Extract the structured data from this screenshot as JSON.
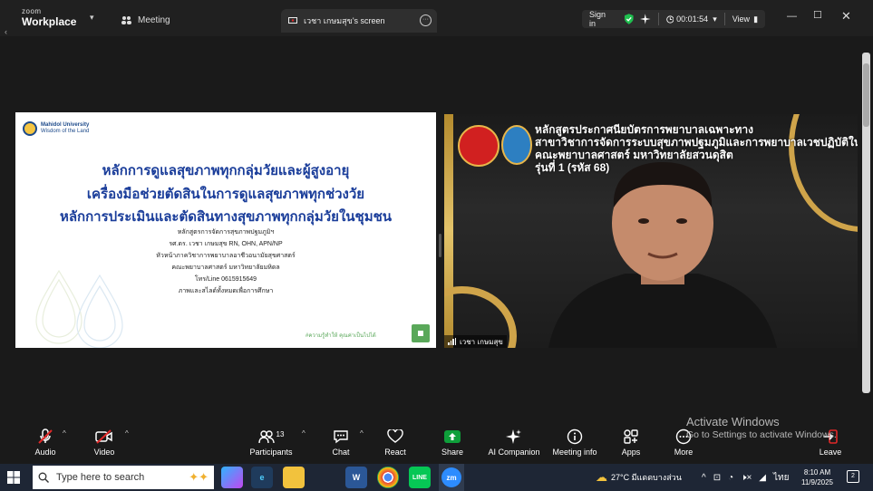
{
  "app": {
    "logo_top": "zoom",
    "logo_bottom": "Workplace",
    "meeting_label": "Meeting"
  },
  "tab": {
    "title": "เวชา เกษมสุข's screen"
  },
  "header": {
    "sign_in": "Sign in",
    "timer": "00:01:54",
    "view": "View"
  },
  "slide": {
    "uni_name": "Mahidol University",
    "uni_motto": "Wisdom of the Land",
    "title_lines": [
      "หลักการดูแลสุขภาพทุกกลุ่มวัยและผู้สูงอายุ",
      "เครื่องมือช่วยตัดสินในการดูแลสุขภาพทุกช่วงวัย",
      "หลักการประเมินและตัดสินทางสุขภาพทุกกลุ่มวัยในชุมชน"
    ],
    "sub_lines": [
      "หลักสูตรการจัดการสุขภาพปฐมภูมิฯ",
      "รศ.ดร. เวชา เกษมสุข RN, OHN, APN/NP",
      "หัวหน้าภาควิชาการพยาบาลอาชีวอนามัยสุขศาสตร์",
      "คณะพยาบาลศาสตร์ มหาวิทยาลัยมหิดล",
      "โทร/Line 0615915649",
      "ภาพและสไลด์ทั้งหมดเพื่อการศึกษา"
    ],
    "slogan": "#ความรู้ทำให้ คุณค่าเป็นไปได้"
  },
  "video": {
    "course_lines": [
      "หลักสูตรประกาศนียบัตรการพยาบาลเฉพาะทาง",
      "สาขาวิชาการจัดการระบบสุขภาพปฐมภูมิและการพยาบาลเวชปฏิบัติในชุมชน",
      "คณะพยาบาลศาสตร์ มหาวิทยาลัยสวนดุสิต",
      "รุ่นที่ 1 (รหัส 68)"
    ],
    "participant_name": "เวชา เกษมสุข"
  },
  "toolbar": {
    "audio": "Audio",
    "video": "Video",
    "participants": "Participants",
    "participants_count": "13",
    "chat": "Chat",
    "react": "React",
    "share": "Share",
    "ai": "AI Companion",
    "info": "Meeting info",
    "apps": "Apps",
    "more": "More",
    "leave": "Leave"
  },
  "watermark": {
    "line1": "Activate Windows",
    "line2": "Go to Settings to activate Windows."
  },
  "taskbar": {
    "search_placeholder": "Type here to search",
    "weather": "27°C มีแดดบางส่วน",
    "lang": "ไทย",
    "time": "8:10 AM",
    "date": "11/9/2025",
    "notif_count": "2"
  },
  "colors": {
    "accent": "#0b5cff",
    "share_green": "#0e9f3a",
    "slide_title": "#1a3d9a",
    "leave_red": "#e02828"
  }
}
